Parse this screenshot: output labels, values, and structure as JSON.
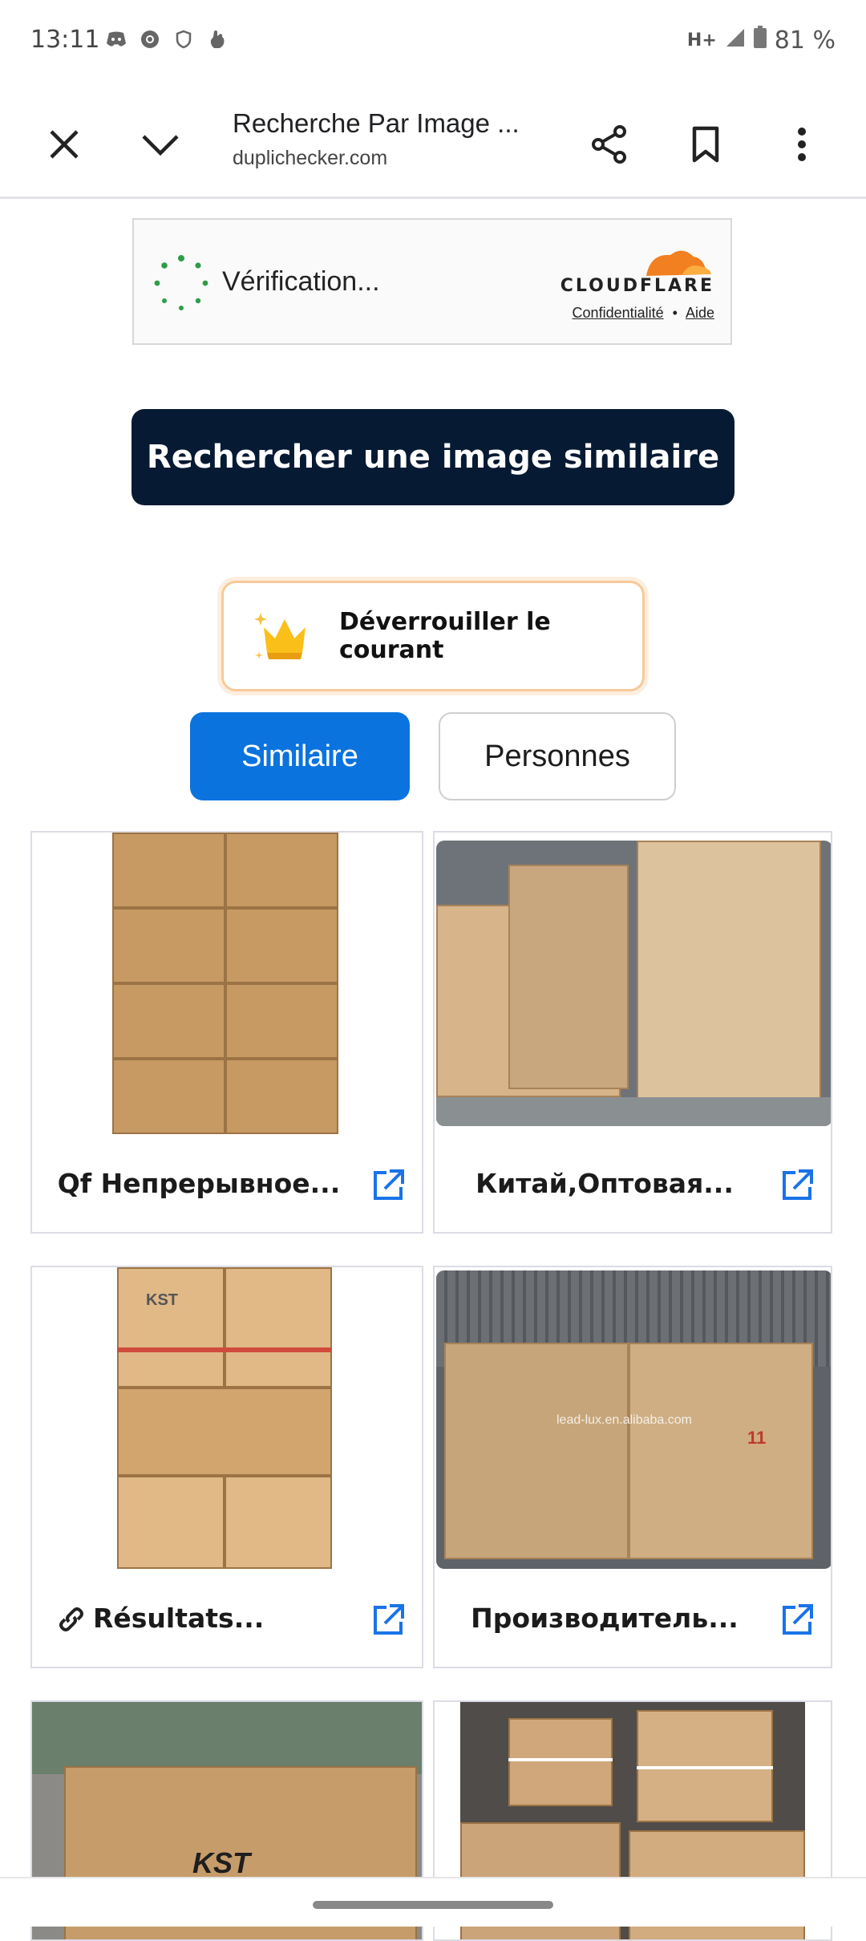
{
  "status_bar": {
    "time": "13:11",
    "network": "H+",
    "battery": "81 %",
    "icons": [
      "discord-icon",
      "chrome-icon",
      "vpn-shield-icon",
      "hand-icon"
    ]
  },
  "toolbar": {
    "title": "Recherche Par Image ...",
    "url": "duplichecker.com",
    "icons": [
      "close-icon",
      "chevron-down-icon",
      "share-icon",
      "bookmark-icon",
      "more-vert-icon"
    ]
  },
  "cloudflare": {
    "status": "Vérification...",
    "brand": "CLOUDFLARE",
    "privacy_link": "Confidentialité",
    "separator": "•",
    "help_link": "Aide"
  },
  "search_button": "Rechercher une image similaire",
  "unlock_button": "Déverrouiller le courant",
  "tabs": [
    {
      "label": "Similaire",
      "active": true
    },
    {
      "label": "Personnes",
      "active": false
    }
  ],
  "results": [
    {
      "caption": "Qf Непрерывное..."
    },
    {
      "caption": "Китай,Оптовая..."
    },
    {
      "caption": "Résultats..."
    },
    {
      "caption": "Производитель..."
    }
  ],
  "image_text": {
    "watermark": "lead-lux.en.alibaba.com",
    "kst": "KST",
    "box_label": "11"
  },
  "colors": {
    "primary_button": "#061a33",
    "active_tab": "#0b73de",
    "link_icon": "#1a73e8",
    "cloudflare_orange": "#f38020"
  }
}
